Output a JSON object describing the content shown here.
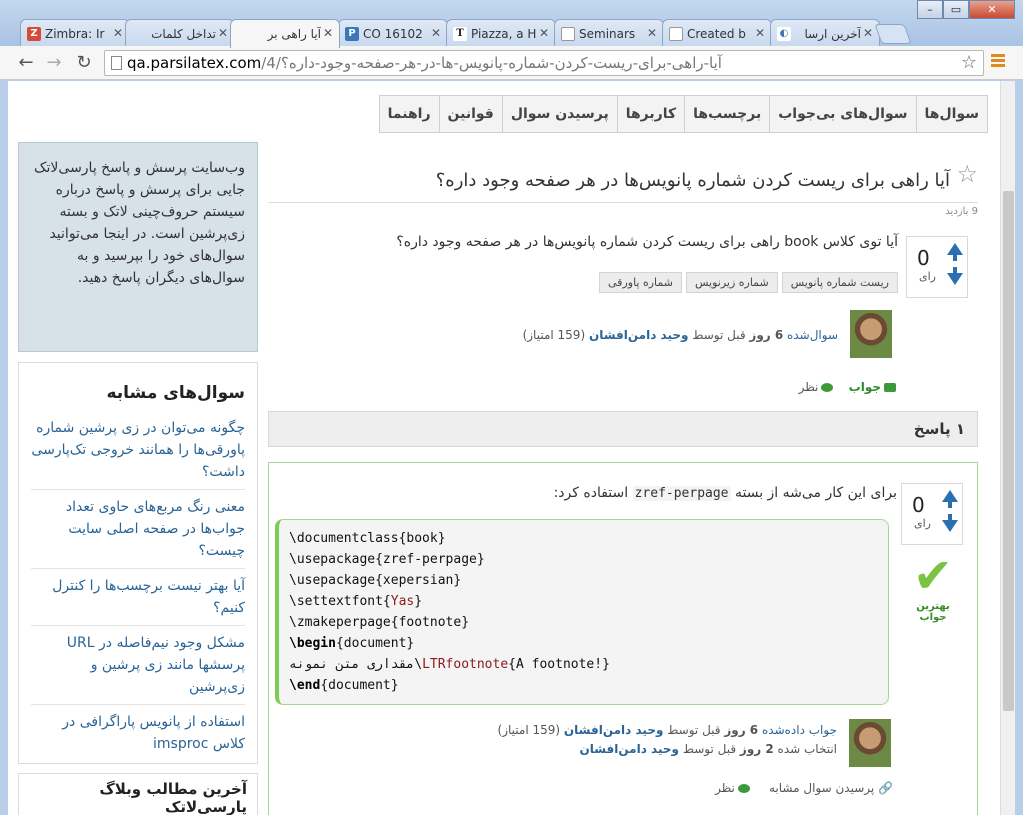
{
  "browser": {
    "tabs": [
      {
        "label": "Zimbra: Ir",
        "fav": "Z",
        "fav_color": "#d64a3a"
      },
      {
        "label": "تداخل کلمات",
        "fav": "",
        "fav_color": "#ffffff"
      },
      {
        "label": "آیا راهی بر",
        "fav": "",
        "fav_color": "#ffffff"
      },
      {
        "label": "CO 16102",
        "fav": "P",
        "fav_color": "#3a78b8"
      },
      {
        "label": "Piazza, a H",
        "fav": "T",
        "fav_color": "#333333"
      },
      {
        "label": "Seminars",
        "fav": "",
        "fav_color": "#ffffff"
      },
      {
        "label": "Created b",
        "fav": "",
        "fav_color": "#ffffff"
      },
      {
        "label": "آخرین ارسا",
        "fav": "",
        "fav_color": "#ffffff"
      }
    ],
    "url_host": "qa.parsilatex.com",
    "url_path": "/4/آیا-راهی-برای-ریست-کردن-شماره-پانویس-ها-در-هر-صفحه-وجود-داره؟",
    "icons": [
      "back-icon",
      "forward-icon",
      "reload-icon",
      "page-icon",
      "star-icon",
      "menu-icon"
    ]
  },
  "nav": [
    "سوال‌ها",
    "سوال‌های بی‌جواب",
    "برچسب‌ها",
    "کاربرها",
    "پرسیدن سوال",
    "قوانین",
    "راهنما"
  ],
  "sidebar": {
    "intro": "وب‌سایت پرسش و پاسخ پارسی‌لاتک جایی برای پرسش و پاسخ درباره سیستم حروف‌چینی لاتک و بسته زی‌پرشین است. در اینجا می‌توانید سوال‌های خود را بپرسید و به سوال‌های دیگران پاسخ دهید.",
    "related_title": "سوال‌های مشابه",
    "related": [
      "چگونه می‌توان در زی پرشین شماره پاورقی‌ها را همانند خروجی تک‌پارسی داشت؟",
      "معنی رنگ مربع‌های حاوی تعداد جواب‌ها در صفحه اصلی سایت چیست؟",
      "آیا بهتر نیست برچسب‌ها را کنترل کنیم؟",
      "مشکل وجود نیم‌فاصله در URL پرسشها مانند زی پرشین و زی‌پرشین",
      "استفاده از پانویس پاراگرافی در کلاس imsproc"
    ],
    "blog_title": "آخرین مطالب وبلاگ پارسی‌لاتک"
  },
  "question": {
    "title": "آیا راهی برای ریست کردن شماره پانویس‌ها در هر صفحه وجود داره؟",
    "views": "9 بازدید",
    "votes": "0",
    "vote_label": "رای",
    "body": "آیا توی کلاس book راهی برای ریست کردن شماره پانویس‌ها در هر صفحه وجود داره؟",
    "tags": [
      "ریست شماره پانویس",
      "شماره زیرنویس",
      "شماره پاورقی"
    ],
    "meta_prefix": "سوال‌شده",
    "meta_time": "6 روز",
    "meta_mid": "قبل توسط",
    "author": "وحید دامن‌افشان",
    "points": "(159 امتیاز)",
    "answer_btn": "جواب",
    "comment_btn": "نظر"
  },
  "answers_header": "۱ پاسخ",
  "answer": {
    "votes": "0",
    "vote_label": "رای",
    "text_before": "برای این کار می‌شه از بسته",
    "text_code": "zref-perpage",
    "text_after": "استفاده کرد:",
    "code": [
      {
        "pre": "\\documentclass{",
        "arg": "",
        "post": "book}"
      },
      {
        "pre": "\\usepackage{",
        "arg": "",
        "post": "zref-perpage}"
      },
      {
        "pre": "\\usepackage{",
        "arg": "",
        "post": "xepersian}"
      },
      {
        "pre": "\\settextfont{",
        "arg": "Yas",
        "post": "}"
      },
      {
        "pre": "\\zmakeperpage{",
        "arg": "",
        "post": "footnote}"
      },
      {
        "pre": "\\begin",
        "arg": "",
        "post": "{document}"
      },
      {
        "pre": "مقداری متن نمونه\\",
        "arg": "LTRfootnote",
        "post": "{A footnote!}"
      },
      {
        "pre": "\\end",
        "arg": "",
        "post": "{document}"
      }
    ],
    "best_label": "بهترین جواب",
    "meta1_prefix": "جواب داده‌شده",
    "meta1_time": "6 روز",
    "meta1_mid": "قبل توسط",
    "meta1_author": "وحید دامن‌افشان",
    "meta1_points": "(159 امتیاز)",
    "meta2_prefix": "انتخاب شده",
    "meta2_time": "2 روز",
    "meta2_mid": "قبل توسط",
    "meta2_author": "وحید دامن‌افشان",
    "ask_related": "پرسیدن سوال مشابه",
    "comment_btn": "نظر"
  }
}
